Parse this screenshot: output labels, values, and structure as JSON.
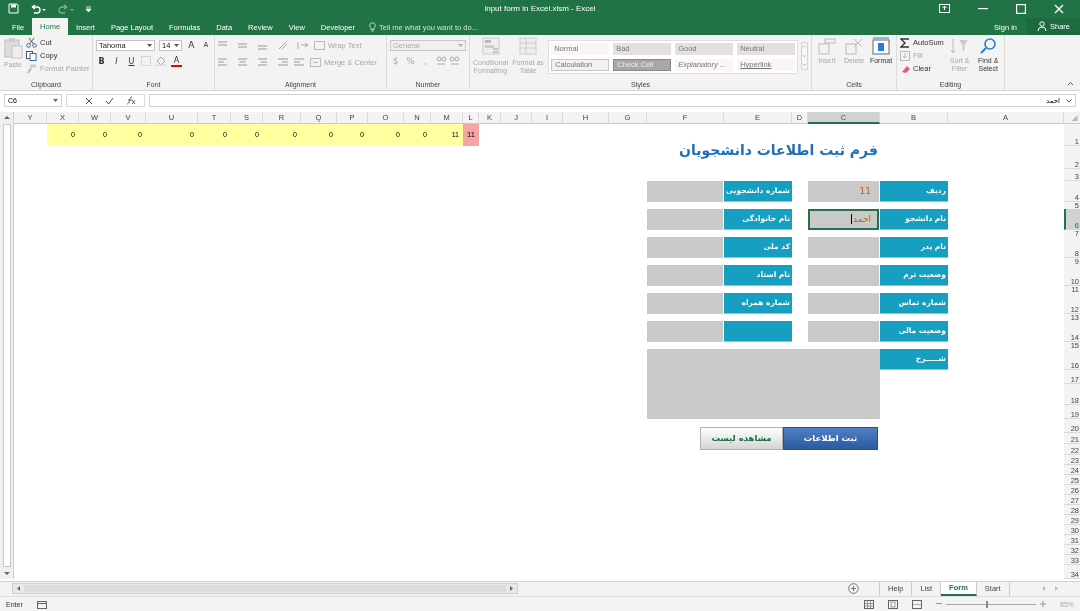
{
  "window": {
    "title": "input form in Excel.xlsm - Excel"
  },
  "account": {
    "sign_in": "Sign in",
    "share": "Share"
  },
  "tabs": [
    {
      "label": "File",
      "selected": false
    },
    {
      "label": "Home",
      "selected": true
    },
    {
      "label": "Insert",
      "selected": false
    },
    {
      "label": "Page Layout",
      "selected": false
    },
    {
      "label": "Formulas",
      "selected": false
    },
    {
      "label": "Data",
      "selected": false
    },
    {
      "label": "Review",
      "selected": false
    },
    {
      "label": "View",
      "selected": false
    },
    {
      "label": "Developer",
      "selected": false
    }
  ],
  "tell_me": {
    "placeholder": "Tell me what you want to do..."
  },
  "ribbon": {
    "clipboard": {
      "label": "Clipboard",
      "paste": {
        "label": "Paste",
        "disabled": true
      },
      "cut": {
        "label": "Cut",
        "disabled": false
      },
      "copy": {
        "label": "Copy",
        "disabled": false
      },
      "format_painter": {
        "label": "Format Painter",
        "disabled": true
      }
    },
    "font": {
      "label": "Font",
      "font_name": "Tahoma",
      "font_size": "14",
      "grow": "A",
      "shrink": "A",
      "bold": "B",
      "italic": "I",
      "underline": "U",
      "font_color": "A"
    },
    "alignment": {
      "label": "Alignment",
      "wrap_text": {
        "label": "Wrap Text",
        "disabled": true
      },
      "merge": {
        "label": "Merge & Center",
        "disabled": true
      }
    },
    "number": {
      "label": "Number",
      "format": {
        "value": "General",
        "disabled": true
      },
      "currency": "$",
      "percent": "%",
      "comma": ","
    },
    "styles": {
      "label": "Styles",
      "conditional": {
        "label": "Conditional Formatting",
        "disabled": true
      },
      "format_table": {
        "label": "Format as Table",
        "disabled": true
      },
      "gallery": [
        {
          "label": "Normal",
          "kind": "plain",
          "color": "#fbf4f8"
        },
        {
          "label": "Bad",
          "kind": "plain",
          "color": "#e4dfe2"
        },
        {
          "label": "Good",
          "kind": "plain",
          "color": "#e4dfe2"
        },
        {
          "label": "Neutral",
          "kind": "plain",
          "color": "#e4dfe2"
        },
        {
          "label": "Calculation",
          "kind": "boxed",
          "color": "#f4eff2"
        },
        {
          "label": "Check Cell",
          "kind": "check",
          "color": "#a8a6a7"
        },
        {
          "label": "Explanatory ...",
          "kind": "italic",
          "color": "#fbf4f8"
        },
        {
          "label": "Hyperlink",
          "kind": "link",
          "color": "#fbf4f8"
        }
      ]
    },
    "cells": {
      "label": "Cells",
      "insert": {
        "label": "Insert",
        "disabled": true
      },
      "delete": {
        "label": "Delete",
        "disabled": true
      },
      "format": {
        "label": "Format",
        "disabled": false
      }
    },
    "editing": {
      "label": "Editing",
      "autosum": {
        "label": "AutoSum",
        "disabled": false
      },
      "fill": {
        "label": "Fill",
        "disabled": true
      },
      "clear": {
        "label": "Clear",
        "disabled": false
      },
      "sort": {
        "label": "Sort & Filter",
        "disabled": true
      },
      "find": {
        "label": "Find & Select",
        "disabled": false
      }
    }
  },
  "formula_bar": {
    "name_box": "C6",
    "value": "احمد"
  },
  "columns": [
    {
      "label": "Y",
      "selected": false
    },
    {
      "label": "X",
      "selected": false
    },
    {
      "label": "W",
      "selected": false
    },
    {
      "label": "V",
      "selected": false
    },
    {
      "label": "U",
      "selected": false
    },
    {
      "label": "T",
      "selected": false
    },
    {
      "label": "S",
      "selected": false
    },
    {
      "label": "R",
      "selected": false
    },
    {
      "label": "Q",
      "selected": false
    },
    {
      "label": "P",
      "selected": false
    },
    {
      "label": "O",
      "selected": false
    },
    {
      "label": "N",
      "selected": false
    },
    {
      "label": "M",
      "selected": false
    },
    {
      "label": "L",
      "selected": false
    },
    {
      "label": "K",
      "selected": false
    },
    {
      "label": "J",
      "selected": false
    },
    {
      "label": "I",
      "selected": false
    },
    {
      "label": "H",
      "selected": false
    },
    {
      "label": "G",
      "selected": false
    },
    {
      "label": "F",
      "selected": false
    },
    {
      "label": "E",
      "selected": false
    },
    {
      "label": "D",
      "selected": false
    },
    {
      "label": "C",
      "selected": true
    },
    {
      "label": "B",
      "selected": false
    },
    {
      "label": "A",
      "selected": false
    }
  ],
  "rows": [
    {
      "label": "1",
      "selected": false
    },
    {
      "label": "2",
      "selected": false
    },
    {
      "label": "3",
      "selected": false
    },
    {
      "label": "4",
      "selected": false
    },
    {
      "label": "5",
      "selected": false
    },
    {
      "label": "6",
      "selected": true
    },
    {
      "label": "7",
      "selected": false
    },
    {
      "label": "8",
      "selected": false
    },
    {
      "label": "9",
      "selected": false
    },
    {
      "label": "10",
      "selected": false
    },
    {
      "label": "11",
      "selected": false
    },
    {
      "label": "12",
      "selected": false
    },
    {
      "label": "13",
      "selected": false
    },
    {
      "label": "14",
      "selected": false
    },
    {
      "label": "15",
      "selected": false
    },
    {
      "label": "16",
      "selected": false
    },
    {
      "label": "17",
      "selected": false
    },
    {
      "label": "18",
      "selected": false
    },
    {
      "label": "19",
      "selected": false
    },
    {
      "label": "20",
      "selected": false
    },
    {
      "label": "21",
      "selected": false
    },
    {
      "label": "22",
      "selected": false
    },
    {
      "label": "23",
      "selected": false
    },
    {
      "label": "24",
      "selected": false
    },
    {
      "label": "25",
      "selected": false
    },
    {
      "label": "26",
      "selected": false
    },
    {
      "label": "27",
      "selected": false
    },
    {
      "label": "28",
      "selected": false
    },
    {
      "label": "29",
      "selected": false
    },
    {
      "label": "30",
      "selected": false
    },
    {
      "label": "31",
      "selected": false
    },
    {
      "label": "32",
      "selected": false
    },
    {
      "label": "33",
      "selected": false
    },
    {
      "label": "34",
      "selected": false
    }
  ],
  "data_row": {
    "values": [
      "0",
      "0",
      "0",
      "0",
      "0",
      "0",
      "0",
      "0",
      "0",
      "0",
      "0",
      "11"
    ],
    "flag": "11"
  },
  "form": {
    "title": "فرم ثبت اطلاعات دانشجویان",
    "right_fields": [
      {
        "label": "ردیف",
        "value": "11",
        "selected": false
      },
      {
        "label": "نام دانشجو",
        "value": "احمد",
        "selected": true
      },
      {
        "label": "نام پدر",
        "selected": false
      },
      {
        "label": "وضعیت ترم",
        "selected": false
      },
      {
        "label": "شماره تماس",
        "selected": false
      },
      {
        "label": "وضعیت مالی",
        "selected": false
      }
    ],
    "left_fields": [
      {
        "label": "شماره دانشجویی",
        "selected": false
      },
      {
        "label": "نام خانوادگی",
        "selected": false
      },
      {
        "label": "کد ملی",
        "selected": false
      },
      {
        "label": "نام استاد",
        "selected": false
      },
      {
        "label": "شماره همراه",
        "selected": false
      },
      {
        "selected": false
      }
    ],
    "description": {
      "label": "شـــــرح"
    },
    "buttons": [
      {
        "label": "ثبت اطلاعات",
        "kind": "primary"
      },
      {
        "label": "مشاهده لیست",
        "kind": "secondary"
      }
    ]
  },
  "sheet_tabs": [
    {
      "label": "Help",
      "selected": false
    },
    {
      "label": "List",
      "selected": false
    },
    {
      "label": "Form",
      "selected": true
    },
    {
      "label": "Start",
      "selected": false
    }
  ],
  "status_bar": {
    "mode": "Enter",
    "zoom_slider": {
      "level": 0.45
    },
    "zoom": "85%"
  }
}
